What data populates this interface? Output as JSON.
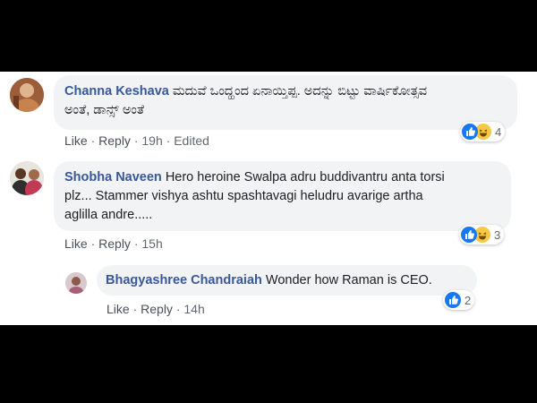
{
  "comments": [
    {
      "author": "Channa Keshava",
      "text_line1": "ಮದುವೆ ಒಂದ್ಹಂದ ಏನಾಯ್ತಿಪ್ಪ. ಅದನ್ನು ಬಿಟ್ಟು ವಾರ್ಷಿಕೋತ್ಸವ",
      "text_line2": "ಅಂತೆ, ಡಾನ್ಸ್ ಅಂತೆ",
      "like": "Like",
      "reply": "Reply",
      "time": "19h",
      "edited": "Edited",
      "reaction_count": "4",
      "reactions": [
        "like-icon",
        "haha-icon"
      ]
    },
    {
      "author": "Shobha Naveen",
      "text_line1": "Hero heroine Swalpa adru buddivantru anta torsi",
      "text_line2": "plz... Stammer vishya ashtu spashtavagi heludru avarige artha",
      "text_line3": "aglilla andre.....",
      "like": "Like",
      "reply": "Reply",
      "time": "15h",
      "reaction_count": "3",
      "reactions": [
        "like-icon",
        "haha-icon"
      ]
    },
    {
      "author": "Bhagyashree Chandraiah",
      "text": "Wonder how Raman is CEO.",
      "like": "Like",
      "reply": "Reply",
      "time": "14h",
      "reaction_count": "2",
      "reactions": [
        "like-icon"
      ]
    }
  ],
  "separator": "·",
  "colors": {
    "link": "#385898",
    "bubble": "#f2f3f5",
    "like": "#1877f2",
    "haha": "#f7c844",
    "background": "#000000"
  }
}
